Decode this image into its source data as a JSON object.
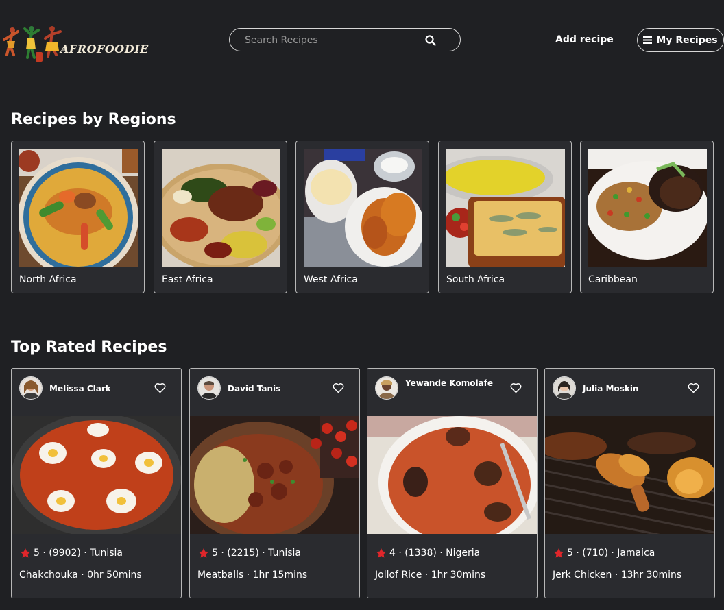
{
  "brand": {
    "name": "AFROFOODIE"
  },
  "header": {
    "search_placeholder": "Search Recipes",
    "add_recipe": "Add recipe",
    "my_recipes": "My Recipes"
  },
  "regions": {
    "heading": "Recipes by Regions",
    "items": [
      {
        "label": "North Africa"
      },
      {
        "label": "East Africa"
      },
      {
        "label": "West Africa"
      },
      {
        "label": "South Africa"
      },
      {
        "label": "Caribbean"
      }
    ]
  },
  "top_rated": {
    "heading": "Top Rated Recipes",
    "cards": [
      {
        "author": "Melissa Clark",
        "rating_line": "5 · (9902) · Tunisia",
        "title_line": "Chakchouka · 0hr 50mins"
      },
      {
        "author": "David Tanis",
        "rating_line": "5 · (2215) · Tunisia",
        "title_line": "Meatballs · 1hr 15mins"
      },
      {
        "author": "Yewande Komolafe",
        "rating_line": "4 · (1338) · Nigeria",
        "title_line": "Jollof Rice · 1hr 30mins"
      },
      {
        "author": "Julia Moskin",
        "rating_line": "5 · (710) · Jamaica",
        "title_line": "Jerk Chicken · 13hr 30mins"
      }
    ]
  },
  "colors": {
    "background": "#1f2023",
    "card": "#2a2b2f",
    "border": "#b7b7b7",
    "star": "#e0262b"
  }
}
